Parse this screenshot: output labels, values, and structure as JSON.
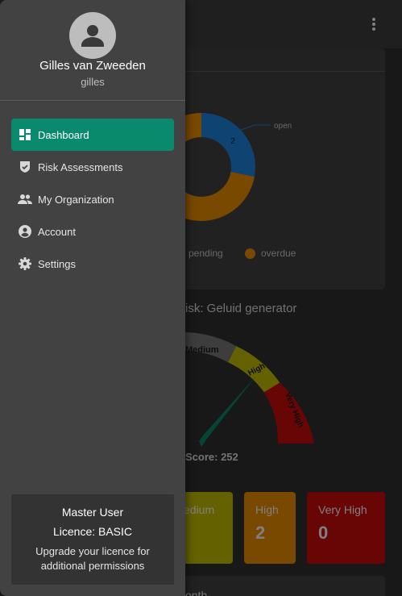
{
  "user": {
    "name": "Gilles van Zweeden",
    "handle": "gilles"
  },
  "nav": {
    "items": [
      {
        "label": "Dashboard",
        "icon": "dashboard-icon",
        "active": true
      },
      {
        "label": "Risk Assessments",
        "icon": "shield-check-icon",
        "active": false
      },
      {
        "label": "My Organization",
        "icon": "people-icon",
        "active": false
      },
      {
        "label": "Account",
        "icon": "account-circle-icon",
        "active": false
      },
      {
        "label": "Settings",
        "icon": "gear-icon",
        "active": false
      }
    ]
  },
  "licence": {
    "role": "Master User",
    "plan": "Licence: BASIC",
    "upgrade_text": "Upgrade your licence for additional permissions"
  },
  "background": {
    "donut_label_open": "open",
    "donut_value_open": "2",
    "legend_pending": "pending",
    "legend_overdue": "overdue",
    "risk_title": "isk: Geluid generator",
    "gauge_label_medium": "Medium",
    "gauge_label_high": "High",
    "gauge_label_very_high": "Very High",
    "score_label": "Score: 252",
    "cards": {
      "medium_label": "edium",
      "high_label": "High",
      "high_value": "2",
      "very_high_label": "Very High",
      "very_high_value": "0"
    },
    "bottom_card_label": "onth"
  },
  "colors": {
    "accent": "#0a8a6c",
    "open": "#1e88e5",
    "pending_overdue": "#f29200",
    "medium": "#c9c400",
    "high": "#f29200",
    "very_high": "#d10c0c",
    "needle": "#0a8a6c"
  }
}
